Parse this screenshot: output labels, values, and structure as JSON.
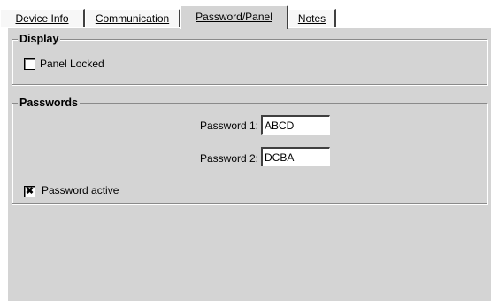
{
  "tabs": [
    {
      "label": "Device Info",
      "active": false
    },
    {
      "label": "Communication",
      "active": false
    },
    {
      "label": "Password/Panel",
      "active": true
    },
    {
      "label": "Notes",
      "active": false
    }
  ],
  "display": {
    "title": "Display",
    "panel_locked": {
      "label": "Panel Locked",
      "checked": false
    }
  },
  "passwords": {
    "title": "Passwords",
    "password1": {
      "label": "Password 1:",
      "value": "ABCD"
    },
    "password2": {
      "label": "Password 2:",
      "value": "DCBA"
    },
    "password_active": {
      "label": "Password active",
      "checked": true
    }
  },
  "colors": {
    "panel": "#d4d4d4",
    "background": "#ffffff"
  }
}
